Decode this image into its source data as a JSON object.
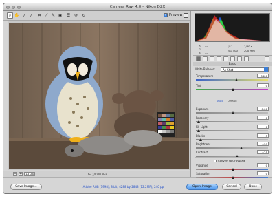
{
  "window": {
    "title": "Camera Raw 4.0  –  Nikon D2X"
  },
  "toolbar": {
    "tools": [
      "zoom-icon",
      "hand-icon",
      "white-balance-icon",
      "color-sampler-icon",
      "crop-icon",
      "straighten-icon",
      "spot-removal-icon",
      "red-eye-icon",
      "preferences-icon",
      "rotate-ccw-icon",
      "rotate-cw-icon"
    ],
    "preview_label": "Preview",
    "preview_checked": true
  },
  "image": {
    "filename": "DSC_0040.NEF"
  },
  "zoom": {
    "minus_label": "–",
    "value": "33.3%",
    "plus_label": "+"
  },
  "histogram": {
    "colors": [
      "#ff2a2a",
      "#2aff2a",
      "#2a6bff",
      "#ffffff"
    ]
  },
  "readout": {
    "r_label": "R:",
    "g_label": "G:",
    "b_label": "B:",
    "r": "---",
    "g": "---",
    "b": "---",
    "aperture": "f/11",
    "shutter": "1/30 s",
    "iso": "ISO 400",
    "focal": "200 mm"
  },
  "panel": {
    "section_title": "Basic",
    "white_balance_label": "White Balance:",
    "white_balance_value": "As Shot",
    "auto_label": "Auto",
    "default_label": "Default",
    "convert_label": "Convert to Grayscale",
    "sliders": [
      {
        "label": "Temperature",
        "value": "5800",
        "level": 0.55
      },
      {
        "label": "Tint",
        "value": "0",
        "level": 0.5
      },
      {
        "label": "Exposure",
        "value": "0.00",
        "level": 0.5
      },
      {
        "label": "Recovery",
        "value": "0",
        "level": 0.02
      },
      {
        "label": "Fill Light",
        "value": "0",
        "level": 0.02
      },
      {
        "label": "Blacks",
        "value": "5",
        "level": 0.05
      },
      {
        "label": "Brightness",
        "value": "+50",
        "level": 0.62
      },
      {
        "label": "Contrast",
        "value": "+25",
        "level": 0.56
      },
      {
        "label": "Vibrance",
        "value": "0",
        "level": 0.5
      },
      {
        "label": "Saturation",
        "value": "0",
        "level": 0.5
      }
    ]
  },
  "footer": {
    "save_label": "Save Image...",
    "workflow_link": "Adobe RGB (1998); 8 bit; 4288 by 2848 (12.2MP); 240 ppi",
    "open_label": "Open Image",
    "cancel_label": "Cancel",
    "done_label": "Done"
  }
}
